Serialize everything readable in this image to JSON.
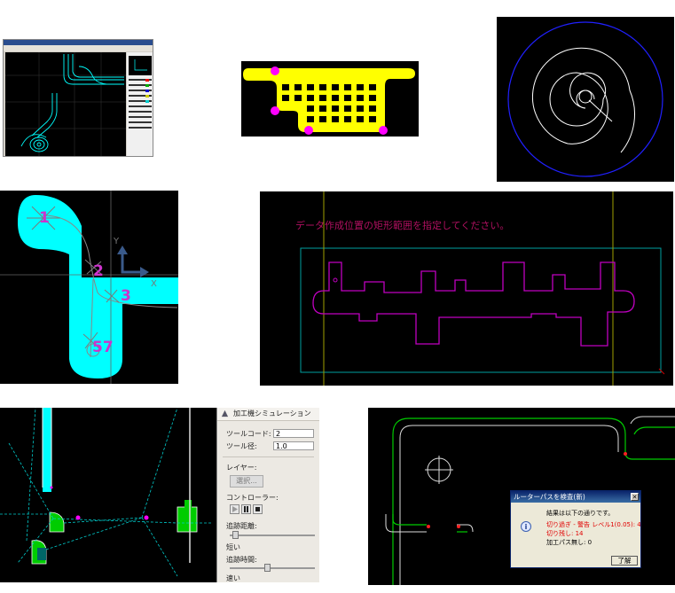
{
  "panel5": {
    "prompt": "データ作成位置の矩形範囲を指定してください。"
  },
  "panel4": {
    "labels": [
      "1",
      "2",
      "3",
      "57"
    ],
    "axis_y": "Y",
    "axis_x": "X"
  },
  "sim": {
    "title": "加工機シミュレーション",
    "tool_code_label": "ツールコード:",
    "tool_code_value": "2",
    "tool_diameter_label": "ツール径:",
    "tool_diameter_value": "1.0",
    "layer_label": "レイヤー:",
    "select_button": "選択...",
    "controller_label": "コントローラー:",
    "tracking_distance_label": "追跡距離:",
    "short_label": "短い",
    "tracking_time_label": "追跡時間:",
    "fast_label": "速い"
  },
  "dialog": {
    "title": "ルーターパスを検査(新)",
    "line1": "結果は以下の通りです。",
    "line2": "切り過ぎ - 警告 レベル1(0.05): 4",
    "line3": "切り残し: 14",
    "line4": "加工パス無し: 0",
    "ok": "了解"
  },
  "colors": {
    "cyan": "#00ffff",
    "yellow": "#ffff00",
    "magenta": "#ff00ff",
    "blue": "#2020ff",
    "green": "#00cc00"
  }
}
